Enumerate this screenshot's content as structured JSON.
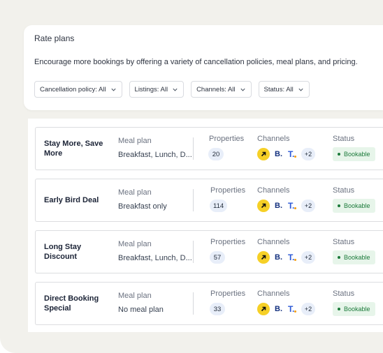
{
  "header": {
    "title": "Rate plans",
    "description": "Encourage more bookings by offering a variety of cancellation policies, meal plans, and pricing."
  },
  "filters": [
    {
      "label": "Cancellation policy: All"
    },
    {
      "label": "Listings: All"
    },
    {
      "label": "Channels: All"
    },
    {
      "label": "Status: All"
    }
  ],
  "columns": {
    "meal_plan": "Meal plan",
    "properties": "Properties",
    "channels": "Channels",
    "status": "Status"
  },
  "rate_plans": [
    {
      "name": "Stay More, Save More",
      "meal_plan": "Breakfast, Lunch, D...",
      "properties": "20",
      "channel_b": "B.",
      "channel_t": "T.",
      "channels_more": "+2",
      "status": "Bookable"
    },
    {
      "name": "Early Bird Deal",
      "meal_plan": "Breakfast only",
      "properties": "114",
      "channel_b": "B.",
      "channel_t": "T.",
      "channels_more": "+2",
      "status": "Bookable"
    },
    {
      "name": "Long Stay Discount",
      "meal_plan": "Breakfast, Lunch, D...",
      "properties": "57",
      "channel_b": "B.",
      "channel_t": "T.",
      "channels_more": "+2",
      "status": "Bookable"
    },
    {
      "name": "Direct Booking Special",
      "meal_plan": "No meal plan",
      "properties": "33",
      "channel_b": "B.",
      "channel_t": "T.",
      "channels_more": "+2",
      "status": "Bookable"
    }
  ],
  "icons": {
    "filter_chevron": "chevron-down-icon",
    "channel_1": "arrow-up-right-icon",
    "status": "status-dot-icon"
  },
  "colors": {
    "background": "#f2f1ec",
    "channel_arrow": "#f6d026",
    "channel_b": "#14317f",
    "channel_t": "#2b58d6",
    "status_bg": "#e7f5ea",
    "status_text": "#1b7a3a",
    "badge_bg": "#e8eef9"
  }
}
